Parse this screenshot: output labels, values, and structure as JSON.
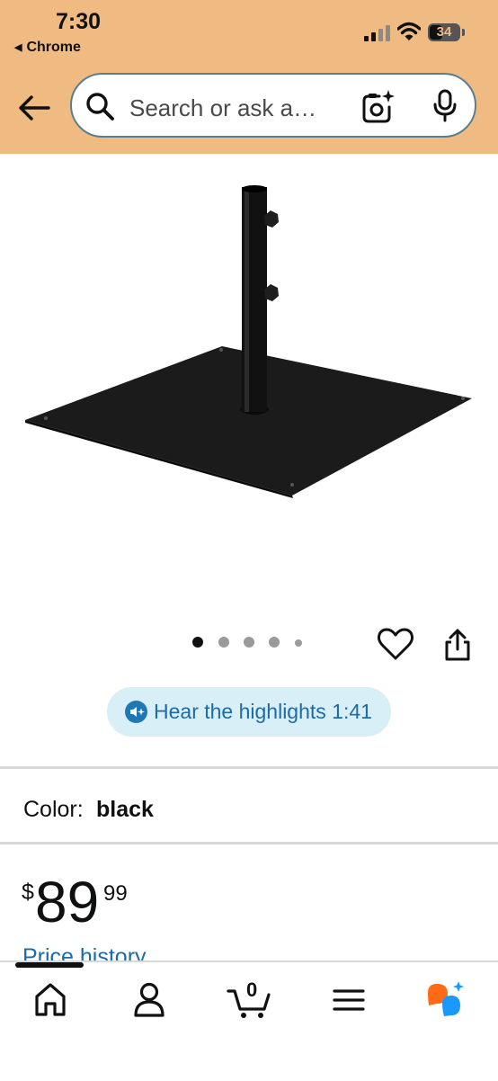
{
  "status_bar": {
    "time": "7:30",
    "back_app": "Chrome",
    "battery": "34"
  },
  "header": {
    "search_placeholder": "Search or ask a…",
    "icons": [
      "back-arrow-icon",
      "search-icon",
      "camera-sparkle-icon",
      "microphone-icon"
    ]
  },
  "gallery": {
    "image_count": 5,
    "active_index": 0,
    "image_subject": "square steel umbrella base with pole and two knobs"
  },
  "audio": {
    "label": "Hear the highlights 1:41"
  },
  "product": {
    "color_label": "Color:",
    "color_value": "black",
    "price_symbol": "$",
    "price_whole": "89",
    "price_fraction": "99",
    "price_history_link": "Price history"
  },
  "bottom_nav": {
    "cart_count": "0",
    "items": [
      "home-icon",
      "account-icon",
      "cart-icon",
      "menu-icon",
      "rufus-icon"
    ]
  },
  "colors": {
    "header_bg": "#efbb82",
    "link": "#1b6ba8",
    "pill_bg": "#d9eff8",
    "rufus_orange": "#ff6a14",
    "rufus_blue": "#1a98ff"
  }
}
